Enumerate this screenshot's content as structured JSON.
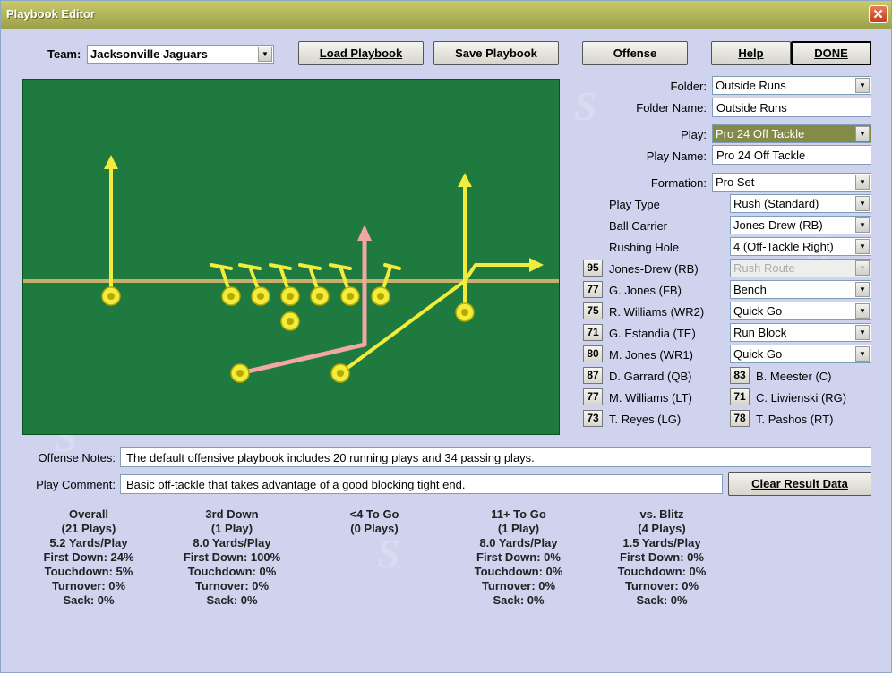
{
  "window": {
    "title": "Playbook Editor",
    "close_glyph": "✕"
  },
  "toolbar": {
    "team_label": "Team:",
    "team_value": "Jacksonville Jaguars",
    "load_label": "Load Playbook",
    "save_label": "Save Playbook",
    "offense_label": "Offense",
    "help_label": "Help",
    "done_label": "DONE"
  },
  "right": {
    "folder_label": "Folder:",
    "folder_value": "Outside Runs",
    "folder_name_label": "Folder Name:",
    "folder_name_value": "Outside Runs",
    "play_label": "Play:",
    "play_value": "Pro 24 Off Tackle",
    "play_name_label": "Play Name:",
    "play_name_value": "Pro 24 Off Tackle",
    "formation_label": "Formation:",
    "formation_value": "Pro Set",
    "play_type_label": "Play Type",
    "play_type_value": "Rush (Standard)",
    "ball_carrier_label": "Ball Carrier",
    "ball_carrier_value": "Jones-Drew (RB)",
    "rushing_hole_label": "Rushing Hole",
    "rushing_hole_value": "4 (Off-Tackle Right)",
    "players": [
      {
        "num": "95",
        "name": "Jones-Drew (RB)",
        "assign": "Rush Route",
        "disabled": true
      },
      {
        "num": "77",
        "name": "G. Jones (FB)",
        "assign": "Bench"
      },
      {
        "num": "75",
        "name": "R. Williams (WR2)",
        "assign": "Quick Go"
      },
      {
        "num": "71",
        "name": "G. Estandia (TE)",
        "assign": "Run Block"
      },
      {
        "num": "80",
        "name": "M. Jones (WR1)",
        "assign": "Quick Go"
      }
    ],
    "linemen": [
      {
        "num": "87",
        "name": "D. Garrard (QB)"
      },
      {
        "num": "83",
        "name": "B. Meester (C)"
      },
      {
        "num": "77",
        "name": "M. Williams (LT)"
      },
      {
        "num": "71",
        "name": "C. Liwienski (RG)"
      },
      {
        "num": "73",
        "name": "T. Reyes (LG)"
      },
      {
        "num": "78",
        "name": "T. Pashos (RT)"
      }
    ]
  },
  "notes": {
    "offense_notes_label": "Offense Notes:",
    "offense_notes_value": "The default offensive playbook includes 20 running plays and 34 passing plays.",
    "play_comment_label": "Play Comment:",
    "play_comment_value": "Basic off-tackle that takes advantage of a good blocking tight end.",
    "clear_label": "Clear Result Data"
  },
  "stats": [
    {
      "lines": [
        "Overall",
        "(21 Plays)",
        "5.2 Yards/Play",
        "First Down: 24%",
        "Touchdown: 5%",
        "Turnover: 0%",
        "Sack: 0%"
      ]
    },
    {
      "lines": [
        "3rd Down",
        "(1 Play)",
        "8.0 Yards/Play",
        "First Down: 100%",
        "Touchdown: 0%",
        "Turnover: 0%",
        "Sack: 0%"
      ]
    },
    {
      "lines": [
        "<4 To Go",
        "(0 Plays)"
      ]
    },
    {
      "lines": [
        "11+ To Go",
        "(1 Play)",
        "8.0 Yards/Play",
        "First Down: 0%",
        "Touchdown: 0%",
        "Turnover: 0%",
        "Sack: 0%"
      ]
    },
    {
      "lines": [
        "vs. Blitz",
        "(4 Plays)",
        "1.5 Yards/Play",
        "First Down: 0%",
        "Touchdown: 0%",
        "Turnover: 0%",
        "Sack: 0%"
      ]
    }
  ],
  "colors": {
    "field": "#1e7a3e",
    "player": "#f2ec3c",
    "route_carrier": "#f2a6a6",
    "line_of_scrimmage": "#c8b06a"
  },
  "icons": {
    "dropdown": "dropdown-arrow-icon",
    "close": "close-icon"
  }
}
